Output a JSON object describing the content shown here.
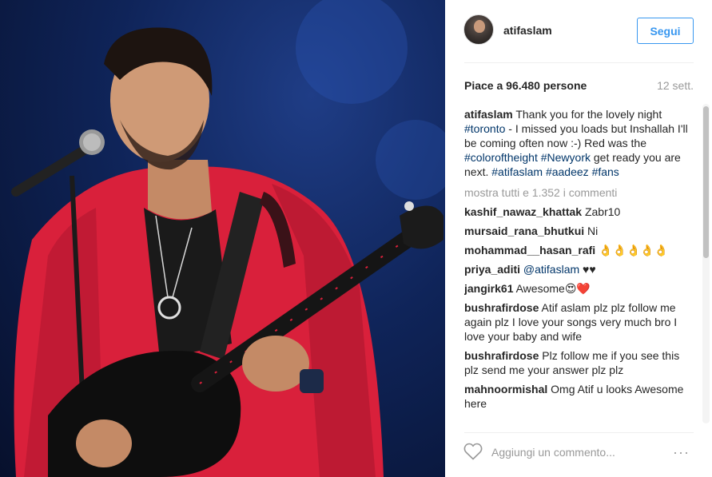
{
  "header": {
    "username": "atifaslam",
    "follow_label": "Segui"
  },
  "stats": {
    "likes_text": "Piace a 96.480 persone",
    "time_ago": "12 sett."
  },
  "caption": {
    "user": "atifaslam",
    "part1": " Thank you for the lovely night ",
    "tag_toronto": "#toronto",
    "part2": " - I missed you loads but Inshallah I'll be coming often now :-) Red was the ",
    "tag_color": "#coloroftheight",
    "part3": " ",
    "tag_newyork": "#Newyork",
    "part4": " get ready you are next. ",
    "tag_atif": "#atifaslam",
    "tag_aadeez": "#aadeez",
    "tag_fans": "#fans"
  },
  "show_all_text": "mostra tutti e 1.352 i commenti",
  "comments": [
    {
      "user": "kashif_nawaz_khattak",
      "text": " Zabr10"
    },
    {
      "user": "mursaid_rana_bhutkui",
      "text": " Ni"
    },
    {
      "user": "mohammad__hasan_rafi",
      "text": " 👌👌👌👌👌"
    },
    {
      "user": "priya_aditi",
      "mention": "@atifaslam",
      "text": " ♥♥"
    },
    {
      "user": "jangirk61",
      "text": " Awesome😍❤️"
    },
    {
      "user": "bushrafirdose",
      "text": " Atif aslam plz plz follow me again plz I love your songs very much bro I love your baby and wife"
    },
    {
      "user": "bushrafirdose",
      "text": " Plz follow me if you see this plz send me your answer plz plz"
    },
    {
      "user": "mahnoormishal",
      "text": " Omg Atif u looks Awesome here"
    }
  ],
  "footer": {
    "comment_placeholder": "Aggiungi un commento...",
    "more_label": "···"
  },
  "icons": {
    "heart": "heart-icon",
    "more": "more-options-icon",
    "avatar": "avatar-image"
  },
  "colors": {
    "accent_blue": "#3897f0",
    "hashtag": "#003569",
    "muted": "#999999"
  }
}
